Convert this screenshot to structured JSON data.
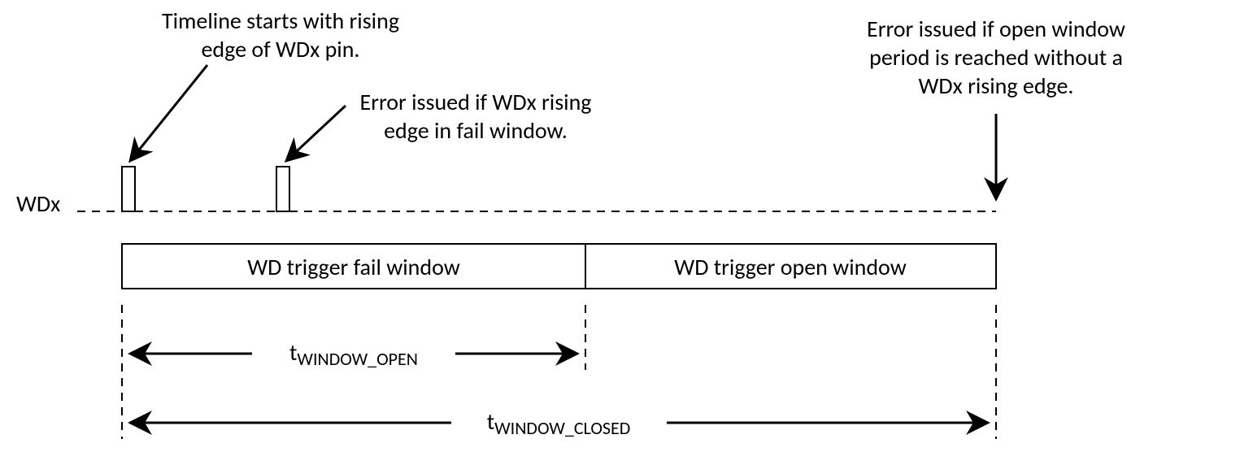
{
  "signal_name": "WDx",
  "annotations": {
    "start": {
      "line1": "Timeline starts with rising",
      "line2": "edge of WDx pin."
    },
    "fail": {
      "line1": "Error issued if WDx rising",
      "line2": "edge in fail window."
    },
    "open": {
      "line1": "Error issued if open window",
      "line2": "period is reached without a",
      "line3": "WDx rising edge."
    }
  },
  "windows": {
    "fail_label": "WD trigger fail window",
    "open_label": "WD trigger open window"
  },
  "measurements": {
    "open": {
      "prefix": "t",
      "sub": "WINDOW_OPEN"
    },
    "closed": {
      "prefix": "t",
      "sub": "WINDOW_CLOSED"
    }
  }
}
